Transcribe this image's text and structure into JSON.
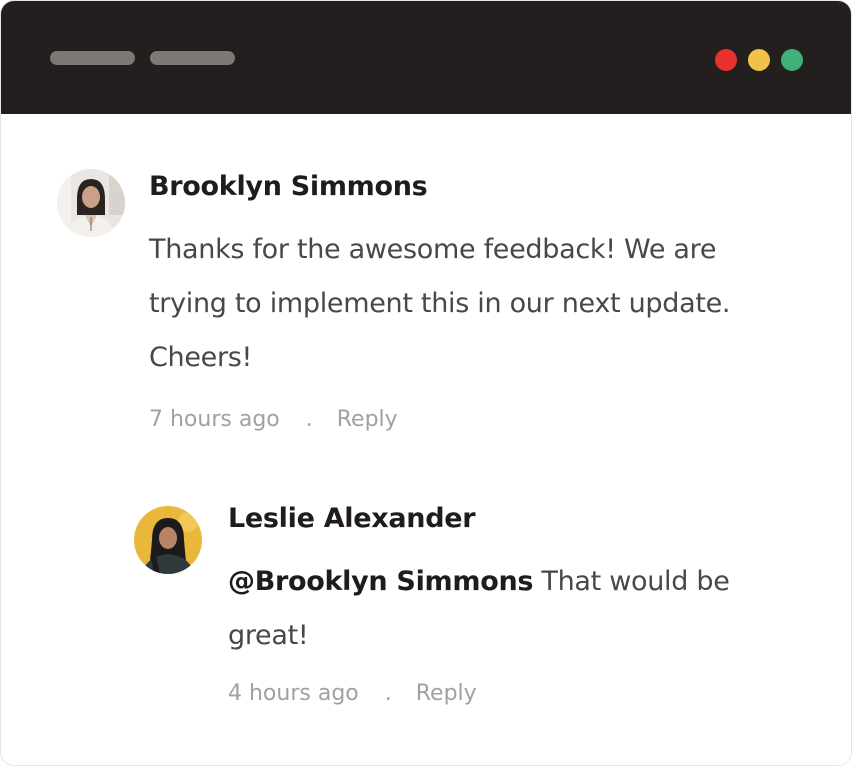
{
  "window": {
    "colors": {
      "titlebar": "#221f1e",
      "pill": "#7d7976",
      "close": "#e8322d",
      "minimize": "#f2c14a",
      "maximize": "#3fb27a"
    }
  },
  "comments": [
    {
      "author": "Brooklyn Simmons",
      "avatar_icon": "woman-portrait-avatar",
      "text": "Thanks for the awesome feedback! We are trying to implement this in our next update. Cheers!",
      "time": "7 hours ago",
      "separator": ".",
      "reply_label": "Reply"
    },
    {
      "author": "Leslie Alexander",
      "avatar_icon": "woman-portrait-avatar-yellow",
      "mention": "@Brooklyn Simmons",
      "text": " That would be great!",
      "time": "4 hours ago",
      "separator": ".",
      "reply_label": "Reply"
    }
  ]
}
